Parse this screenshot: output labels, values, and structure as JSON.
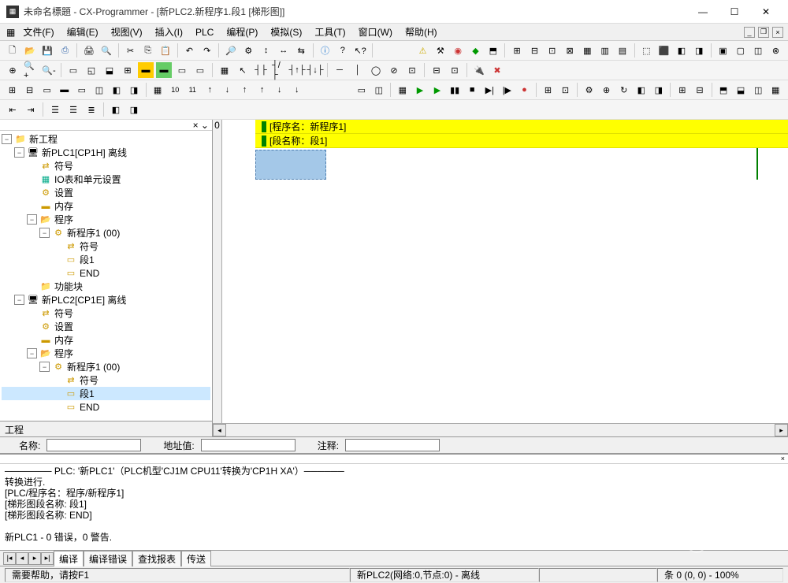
{
  "window": {
    "title": "未命名標題 - CX-Programmer - [新PLC2.新程序1.段1 [梯形图]]",
    "min": "—",
    "max": "☐",
    "close": "✕"
  },
  "menu": {
    "items": [
      "文件(F)",
      "编辑(E)",
      "视图(V)",
      "插入(I)",
      "PLC",
      "编程(P)",
      "模拟(S)",
      "工具(T)",
      "窗口(W)",
      "帮助(H)"
    ]
  },
  "tree": {
    "close": "× ⌄",
    "root": "新工程",
    "plc1": {
      "name": "新PLC1[CP1H] 离线",
      "symbols": "符号",
      "io": "IO表和单元设置",
      "settings": "设置",
      "memory": "内存",
      "programs": "程序",
      "prog1": {
        "name": "新程序1 (00)",
        "symbols": "符号",
        "seg1": "段1",
        "end": "END"
      },
      "funcblocks": "功能块"
    },
    "plc2": {
      "name": "新PLC2[CP1E] 离线",
      "symbols": "符号",
      "settings": "设置",
      "memory": "内存",
      "programs": "程序",
      "prog1": {
        "name": "新程序1 (00)",
        "symbols": "符号",
        "seg1": "段1",
        "end": "END"
      }
    },
    "tab": "工程"
  },
  "ladder": {
    "zero": "0",
    "prog_label": "[程序名：新程序1]",
    "seg_label": "[段名称：段1]"
  },
  "fields": {
    "name": "名称:",
    "addr": "地址值:",
    "comment": "注释:"
  },
  "output": {
    "line1": "─────── PLC: '新PLC1'（PLC机型'CJ1M CPU11'转换为'CP1H XA'）──────",
    "line2": "转换进行.",
    "line3": "[PLC/程序名：程序/新程序1]",
    "line4": "[梯形图段名称: 段1]",
    "line5": "[梯形图段名称: END]",
    "line6": "",
    "line7": "新PLC1 - 0 错误，0 警告.",
    "tabs": [
      "编译",
      "编译错误",
      "查找报表",
      "传送"
    ]
  },
  "status": {
    "help": "需要帮助，请按F1",
    "plc": "新PLC2(网络:0,节点:0) - 离线",
    "row": "条 0 (0, 0) - 100%"
  },
  "watermark": "PLC与自控设备"
}
